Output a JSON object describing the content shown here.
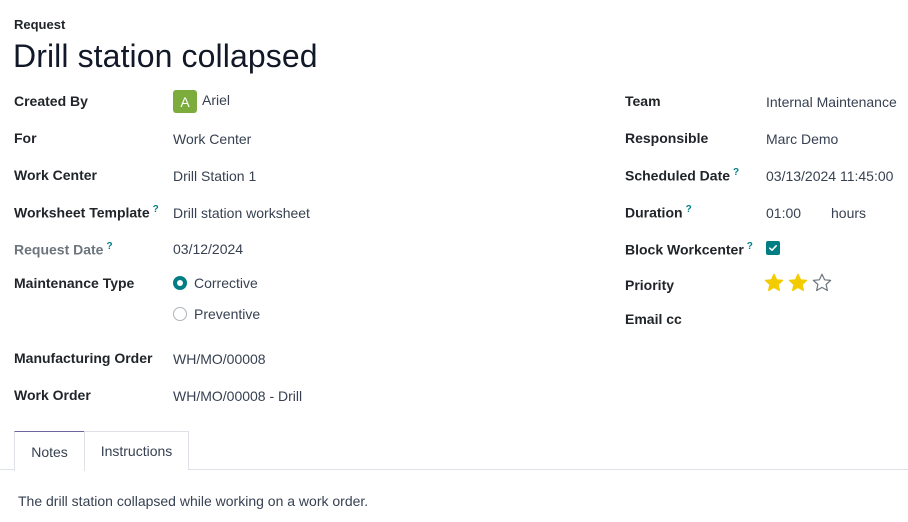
{
  "header": {
    "eyebrow": "Request",
    "title": "Drill station collapsed"
  },
  "left_fields": {
    "created_by": {
      "label": "Created By",
      "avatar_initial": "A",
      "avatar_color": "#7cac3b",
      "value": "Ariel"
    },
    "for": {
      "label": "For",
      "value": "Work Center"
    },
    "work_center": {
      "label": "Work Center",
      "value": "Drill Station 1"
    },
    "worksheet_template": {
      "label": "Worksheet Template",
      "help": "?",
      "value": "Drill station worksheet"
    },
    "request_date": {
      "label": "Request Date",
      "help": "?",
      "value": "03/12/2024"
    },
    "maintenance_type": {
      "label": "Maintenance Type",
      "options": [
        {
          "label": "Corrective",
          "selected": true
        },
        {
          "label": "Preventive",
          "selected": false
        }
      ]
    },
    "manufacturing_order": {
      "label": "Manufacturing Order",
      "value": "WH/MO/00008"
    },
    "work_order": {
      "label": "Work Order",
      "value": "WH/MO/00008 - Drill"
    }
  },
  "right_fields": {
    "team": {
      "label": "Team",
      "value": "Internal Maintenance"
    },
    "responsible": {
      "label": "Responsible",
      "value": "Marc Demo"
    },
    "scheduled_date": {
      "label": "Scheduled Date",
      "help": "?",
      "value": "03/13/2024 11:45:00"
    },
    "duration": {
      "label": "Duration",
      "help": "?",
      "value": "01:00",
      "unit": "hours"
    },
    "block_workcenter": {
      "label": "Block Workcenter",
      "help": "?",
      "checked": true
    },
    "priority": {
      "label": "Priority",
      "value": 2,
      "max": 3
    },
    "email_cc": {
      "label": "Email cc",
      "value": ""
    }
  },
  "tabs": [
    {
      "label": "Notes",
      "active": true
    },
    {
      "label": "Instructions",
      "active": false
    }
  ],
  "notes": {
    "text": "The drill station collapsed while working on a work order."
  },
  "colors": {
    "accent": "#017e84",
    "star_filled": "#f3cc00",
    "star_empty_stroke": "#6c757d",
    "tab_active_top": "#71639e"
  }
}
